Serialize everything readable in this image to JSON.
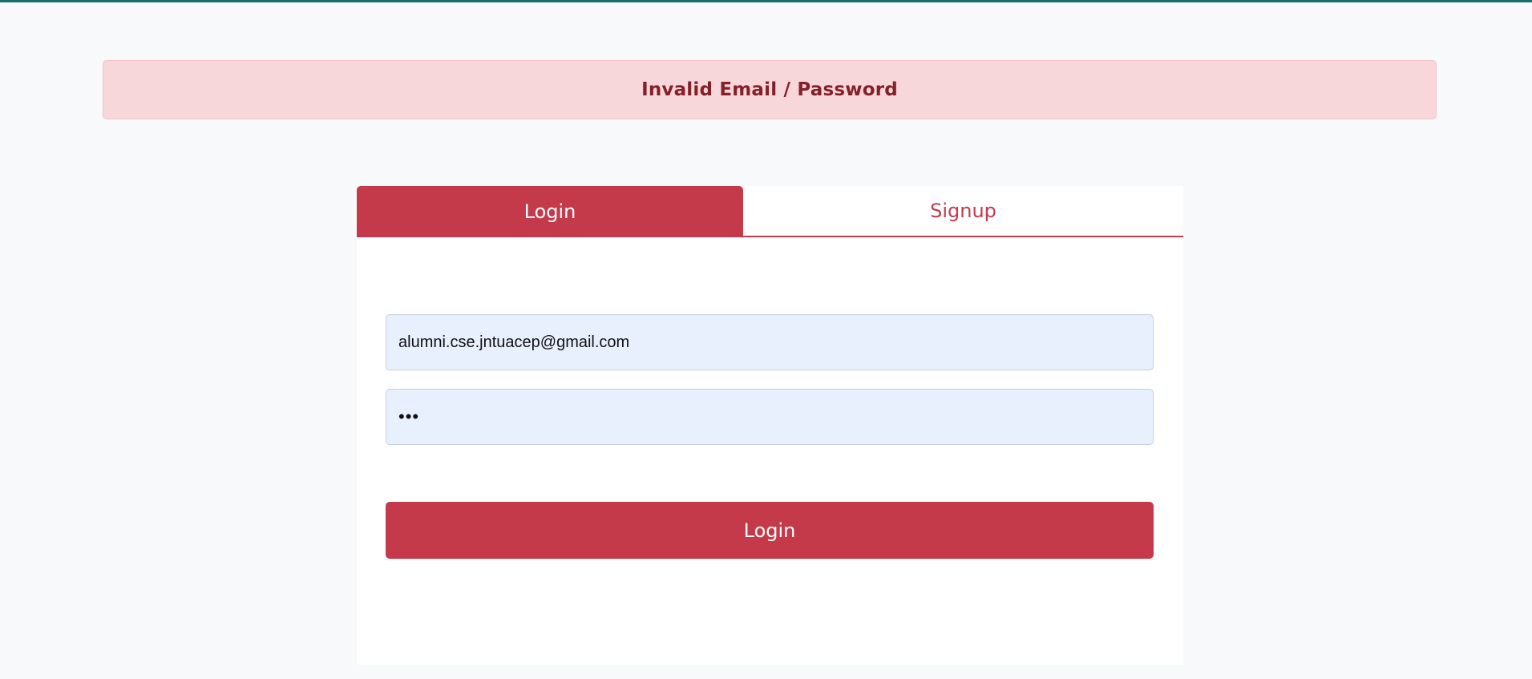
{
  "alert": {
    "message": "Invalid Email / Password"
  },
  "tabs": [
    {
      "label": "Login",
      "active": true
    },
    {
      "label": "Signup",
      "active": false
    }
  ],
  "form": {
    "email_value": "alumni.cse.jntuacep@gmail.com",
    "password_value": "***",
    "submit_label": "Login"
  },
  "colors": {
    "primary": "#c43a4b",
    "alert_bg": "#f8d7da",
    "alert_text": "#842029",
    "field_bg": "#e8f0fe",
    "page_bg": "#f8f9fa",
    "top_strip": "#1a6e70"
  }
}
